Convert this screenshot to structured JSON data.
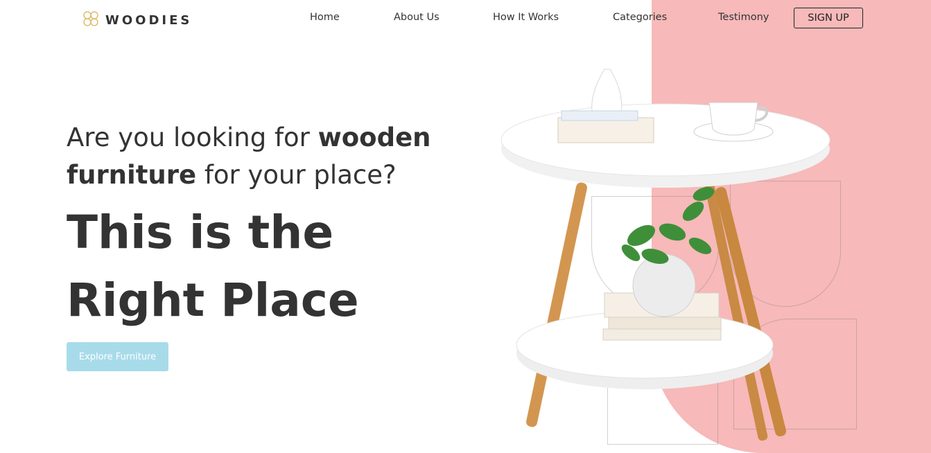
{
  "brand": {
    "name": "WOODIES",
    "logo_icon": "flower-logo-icon"
  },
  "nav": {
    "items": [
      {
        "label": "Home"
      },
      {
        "label": "About Us"
      },
      {
        "label": "How It Works"
      },
      {
        "label": "Categories"
      },
      {
        "label": "Testimony"
      }
    ],
    "signup_label": "SIGN UP"
  },
  "hero": {
    "intro_part1": "Are you looking for ",
    "intro_bold1": "wooden",
    "intro_bold2": "furniture",
    "intro_part2": " for your place?",
    "title_line1": "This is the",
    "title_line2": "Right Place",
    "cta_label": "Explore Furniture"
  },
  "colors": {
    "accent_pink": "#f7b9b9",
    "cta_blue": "#a8dbea",
    "text_dark": "#333333"
  }
}
